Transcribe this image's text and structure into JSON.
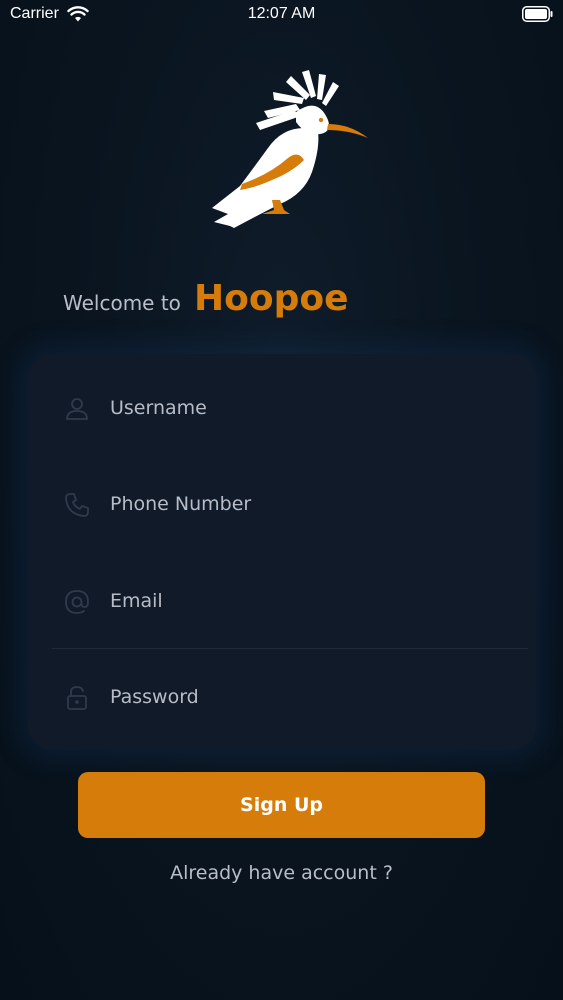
{
  "status_bar": {
    "carrier": "Carrier",
    "time": "12:07 AM"
  },
  "brand": {
    "welcome_prefix": "Welcome to",
    "name": "Hoopoe",
    "accent_color": "#d57c0a"
  },
  "form": {
    "fields": [
      {
        "placeholder": "Username",
        "icon": "user-icon"
      },
      {
        "placeholder": "Phone Number",
        "icon": "phone-icon"
      },
      {
        "placeholder": "Email",
        "icon": "at-sign-icon"
      },
      {
        "placeholder": "Password",
        "icon": "lock-icon"
      }
    ]
  },
  "actions": {
    "signup_label": "Sign Up",
    "login_link": "Already have account ?"
  },
  "colors": {
    "background": "#0a1520",
    "card": "#111a29",
    "accent": "#d57c0a"
  }
}
